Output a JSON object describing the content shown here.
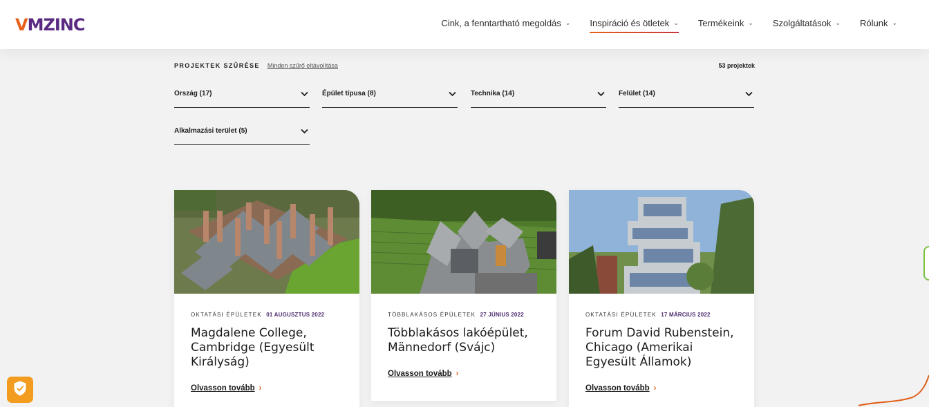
{
  "header": {
    "logo": {
      "v": "V",
      "rest": "MZINC"
    },
    "nav": [
      {
        "label": "Cink, a fenntartható megoldás"
      },
      {
        "label": "Inspiráció és ötletek"
      },
      {
        "label": "Termékeink"
      },
      {
        "label": "Szolgáltatások"
      },
      {
        "label": "Rólunk"
      }
    ],
    "active_nav": "Inspiráció és ötletek",
    "chevron_icon": "chevron-down-icon"
  },
  "filters": {
    "title": "PROJEKTEK SZŰRÉSE",
    "clear_label": "Minden szűrő eltávolítása",
    "count_label": "53 projektek",
    "dropdowns": [
      {
        "label": "Ország (17)"
      },
      {
        "label": "Épület típusa (8)"
      },
      {
        "label": "Technika (14)"
      },
      {
        "label": "Felület (14)"
      },
      {
        "label": "Alkalmazási terület (5)"
      }
    ]
  },
  "cards": [
    {
      "category": "OKTATÁSI ÉPÜLETEK",
      "date": "01 AUGUSZTUS 2022",
      "title": "Magdalene College, Cambridge (Egyesült Királyság)",
      "read_more": "Olvasson tovább"
    },
    {
      "category": "TÖBBLAKÁSOS ÉPÜLETEK",
      "date": "27 JÚNIUS 2022",
      "title": "Többlakásos lakóépület, Männedorf (Svájc)",
      "read_more": "Olvasson tovább"
    },
    {
      "category": "OKTATÁSI ÉPÜLETEK",
      "date": "17 MÁRCIUS 2022",
      "title": "Forum David Rubenstein, Chicago (Amerikai Egyesült Államok)",
      "read_more": "Olvasson tovább"
    }
  ],
  "colors": {
    "accent": "#e8601c",
    "brand_purple": "#5a2a82",
    "date_purple": "#4b2a6e",
    "cookie_orange": "#f29d1f",
    "widget_green": "#7cc142"
  },
  "icons": {
    "cookie": "shield-check-icon",
    "read_more": "chevron-right-icon",
    "dropdown": "chevron-down-icon"
  }
}
